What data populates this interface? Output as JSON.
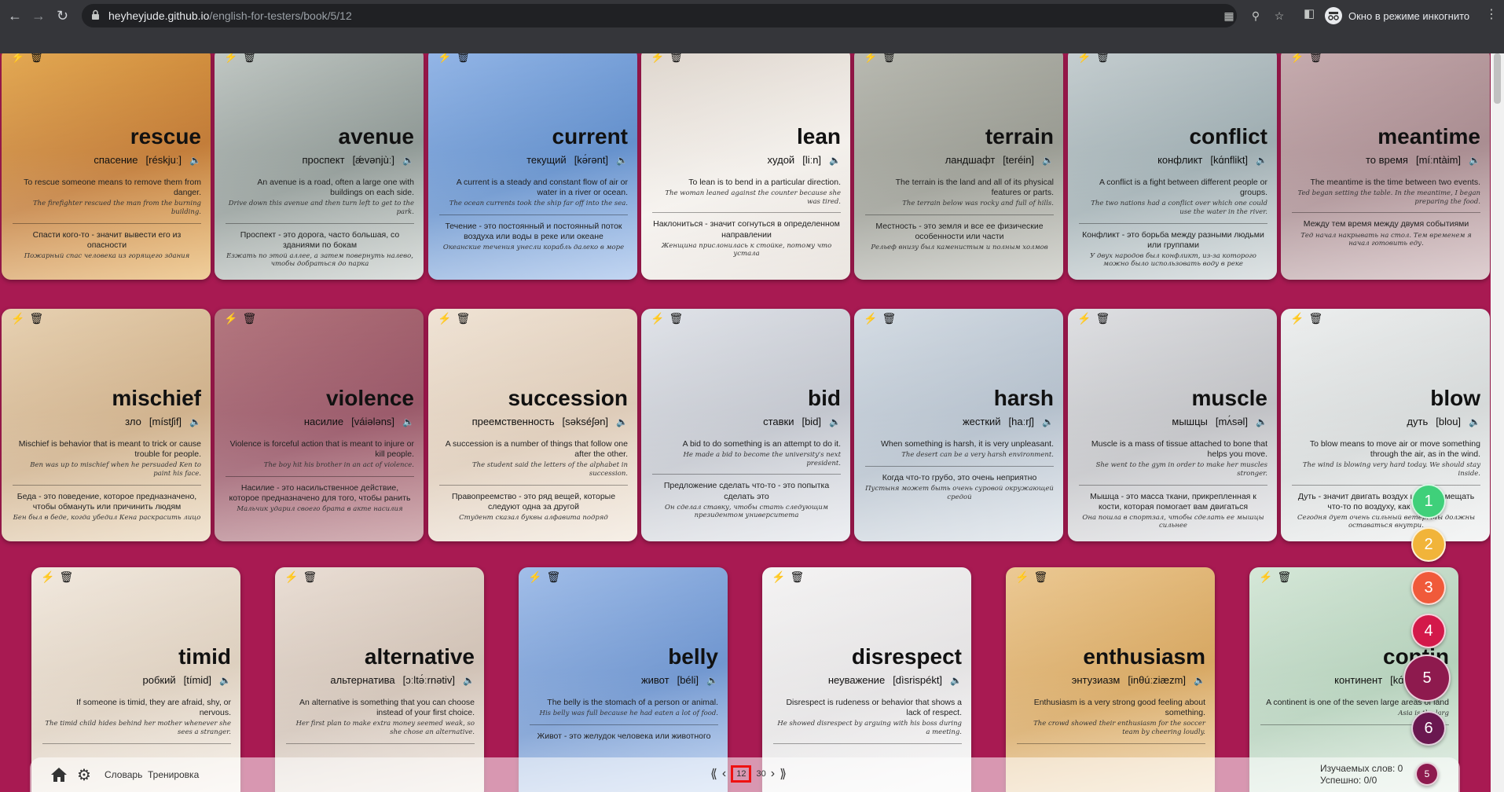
{
  "browser": {
    "url_host": "heyheyjude.github.io",
    "url_path": "/english-for-testers/book/5/12",
    "incognito_label": "Окно в режиме инкогнито"
  },
  "cards": [
    {
      "word": "rescue",
      "ru": "спасение",
      "ipa": "[réskjuː]",
      "def": "To rescue someone means to remove them from danger.",
      "ex": "The firefighter rescued the man from the burning building.",
      "ru_def": "Спасти кого-то - значит вывести его из опасности",
      "ru_ex": "Пожарный спас человека из горящего здания",
      "bg1": "#b9681a",
      "bg2": "#e3a64a"
    },
    {
      "word": "avenue",
      "ru": "проспект",
      "ipa": "[ǽvənjùː]",
      "def": "An avenue is a road, often a large one with buildings on each side.",
      "ex": "Drive down this avenue and then turn left to get to the park.",
      "ru_def": "Проспект - это дорога, часто большая, со зданиями по бокам",
      "ru_ex": "Езжать по этой аллее, а затем повернуть налево, чтобы добраться до парка",
      "bg1": "#7f8a86",
      "bg2": "#bfc6c2"
    },
    {
      "word": "current",
      "ru": "текущий",
      "ipa": "[kə́rənt]",
      "def": "A current is a steady and constant flow of air or water in a river or ocean.",
      "ex": "The ocean currents took the ship far off into the sea.",
      "ru_def": "Течение - это постоянный и постоянный поток воздуха или воды в реке или океане",
      "ru_ex": "Океанские течения унесли корабль далеко в море",
      "bg1": "#4c7fc4",
      "bg2": "#8fb3e6"
    },
    {
      "word": "lean",
      "ru": "худой",
      "ipa": "[liːn]",
      "def": "To lean is to bend in a particular direction.",
      "ex": "The woman leaned against the counter because she was tired.",
      "ru_def": "Наклониться - значит согнуться в определенном направлении",
      "ru_ex": "Женщина прислонилась к стойке, потому что устала",
      "bg1": "#f2eee9",
      "bg2": "#dcd3ca"
    },
    {
      "word": "terrain",
      "ru": "ландшафт",
      "ipa": "[teréin]",
      "def": "The terrain is the land and all of its physical features or parts.",
      "ex": "The terrain below was rocky and full of hills.",
      "ru_def": "Местность - это земля и все ее физические особенности или части",
      "ru_ex": "Рельеф внизу был каменистым и полным холмов",
      "bg1": "#8a8c82",
      "bg2": "#b6b7ae"
    },
    {
      "word": "conflict",
      "ru": "конфликт",
      "ipa": "[kɑ́nflikt]",
      "def": "A conflict is a fight between different people or groups.",
      "ex": "The two nations had a conflict over which one could use the water in the river.",
      "ru_def": "Конфликт - это борьба между разными людьми или группами",
      "ru_ex": "У двух народов был конфликт, из-за которого можно было использовать воду в реке",
      "bg1": "#8fa0a5",
      "bg2": "#c3ccce"
    },
    {
      "word": "meantime",
      "ru": "то время",
      "ipa": "[míːntàim]",
      "def": "The meantime is the time between two events.",
      "ex": "Ted began setting the table. In the meantime, I began preparing the food.",
      "ru_def": "Между тем время между двумя событиями",
      "ru_ex": "Тед начал накрывать на стол. Тем временем я начал готовить еду.",
      "bg1": "#9c7b80",
      "bg2": "#c4a8ab"
    },
    {
      "word": "mischief",
      "ru": "зло",
      "ipa": "[místʃif]",
      "def": "Mischief is behavior that is meant to trick or cause trouble for people.",
      "ex": "Ben was up to mischief when he persuaded Ken to paint his face.",
      "ru_def": "Беда - это поведение, которое предназначено, чтобы обмануть или причинить людям",
      "ru_ex": "Бен был в беде, когда убедил Кена раскрасить лицо",
      "bg1": "#c8a57a",
      "bg2": "#e6cfae"
    },
    {
      "word": "violence",
      "ru": "насилие",
      "ipa": "[váiələns]",
      "def": "Violence is forceful action that is meant to injure or kill people.",
      "ex": "The boy hit his brother in an act of violence.",
      "ru_def": "Насилие - это насильственное действие, которое предназначено для того, чтобы ранить",
      "ru_ex": "Мальчик ударил своего брата в акте насилия",
      "bg1": "#8a3f52",
      "bg2": "#b07078"
    },
    {
      "word": "succession",
      "ru": "преемственность",
      "ipa": "[səkséʃən]",
      "def": "A succession is a number of things that follow one after the other.",
      "ex": "The student said the letters of the alphabet in succession.",
      "ru_def": "Правопреемство - это ряд вещей, которые следуют одна за другой",
      "ru_ex": "Студент сказал буквы алфавита подряд",
      "bg1": "#d8c3ad",
      "bg2": "#efe2d3"
    },
    {
      "word": "bid",
      "ru": "ставки",
      "ipa": "[bid]",
      "def": "A bid to do something is an attempt to do it.",
      "ex": "He made a bid to become the university's next president.",
      "ru_def": "Предложение сделать что-то - это попытка сделать это",
      "ru_ex": "Он сделал ставку, чтобы стать следующим президентом университета",
      "bg1": "#b9bdc6",
      "bg2": "#dfe2e8"
    },
    {
      "word": "harsh",
      "ru": "жесткий",
      "ipa": "[haːrʃ]",
      "def": "When something is harsh, it is very unpleasant.",
      "ex": "The desert can be a very harsh environment.",
      "ru_def": "Когда что-то грубо, это очень неприятно",
      "ru_ex": "Пустыня может быть очень суровой окружающей средой",
      "bg1": "#a9b6c4",
      "bg2": "#d3dbe3"
    },
    {
      "word": "muscle",
      "ru": "мышцы",
      "ipa": "[mʌ́səl]",
      "def": "Muscle is a mass of tissue attached to bone that helps you move.",
      "ex": "She went to the gym in order to make her muscles stronger.",
      "ru_def": "Мышца - это масса ткани, прикрепленная к кости, которая помогает вам двигаться",
      "ru_ex": "Она пошла в спортзал, чтобы сделать ее мышцы сильнее",
      "bg1": "#b7b8bc",
      "bg2": "#dddee1"
    },
    {
      "word": "blow",
      "ru": "дуть",
      "ipa": "[blou]",
      "def": "To blow means to move air or move something through the air, as in the wind.",
      "ex": "The wind is blowing very hard today. We should stay inside.",
      "ru_def": "Дуть - значит двигать воздух или перемещать что-то по воздуху, как на ветру",
      "ru_ex": "Сегодня дует очень сильный ветер. Мы должны оставаться внутри.",
      "bg1": "#cfd3d3",
      "bg2": "#eceeee"
    },
    {
      "word": "timid",
      "ru": "робкий",
      "ipa": "[tímid]",
      "def": "If someone is timid, they are afraid, shy, or nervous.",
      "ex": "The timid child hides behind her mother whenever she sees a stranger.",
      "ru_def": "",
      "ru_ex": "",
      "bg1": "#d8c8b5",
      "bg2": "#f1e8dd"
    },
    {
      "word": "alternative",
      "ru": "альтернатива",
      "ipa": "[ɔːltə́ːrnətiv]",
      "def": "An alternative is something that you can choose instead of your first choice.",
      "ex": "Her first plan to make extra money seemed weak, so she chose an alternative.",
      "ru_def": "",
      "ru_ex": "",
      "bg1": "#c9b8aa",
      "bg2": "#e9ddd3"
    },
    {
      "word": "belly",
      "ru": "живот",
      "ipa": "[béli]",
      "def": "The belly is the stomach of a person or animal.",
      "ex": "His belly was full because he had eaten a lot of food.",
      "ru_def": "Живот - это желудок человека или животного",
      "ru_ex": "",
      "bg1": "#5a86c8",
      "bg2": "#9dbbe8"
    },
    {
      "word": "disrespect",
      "ru": "неуважение",
      "ipa": "[dìsrispékt]",
      "def": "Disrespect is rudeness or behavior that shows a lack of respect.",
      "ex": "He showed disrespect by arguing with his boss during a meeting.",
      "ru_def": "",
      "ru_ex": "",
      "bg1": "#e0dedf",
      "bg2": "#f4f3f3"
    },
    {
      "word": "enthusiasm",
      "ru": "энтузиазм",
      "ipa": "[inθúːziæzm]",
      "def": "Enthusiasm is a very strong good feeling about something.",
      "ex": "The crowd showed their enthusiasm for the soccer team by cheering loudly.",
      "ru_def": "",
      "ru_ex": "",
      "bg1": "#d19a4a",
      "bg2": "#ebc78f"
    },
    {
      "word": "contin",
      "ru": "континент",
      "ipa": "[kɑ́ntəne",
      "def": "A continent is one of the seven large areas of land",
      "ex": "Asia is the larg",
      "ru_def": "",
      "ru_ex": "",
      "bg1": "#a9c9b0",
      "bg2": "#d3e6d6"
    }
  ],
  "levels": [
    {
      "label": "1",
      "color": "#3fd07a"
    },
    {
      "label": "2",
      "color": "#f1b43a"
    },
    {
      "label": "3",
      "color": "#f05a3a"
    },
    {
      "label": "4",
      "color": "#d3194a"
    },
    {
      "label": "5",
      "color": "#8e1a4e"
    },
    {
      "label": "6",
      "color": "#6a1850"
    }
  ],
  "bottom": {
    "dictionary": "Словарь",
    "training": "Тренировка",
    "page_current": "12",
    "page_total": "30",
    "words_learning": "Изучаемых слов: 0",
    "success": "Успешно: 0/0",
    "mini_level": "5"
  }
}
